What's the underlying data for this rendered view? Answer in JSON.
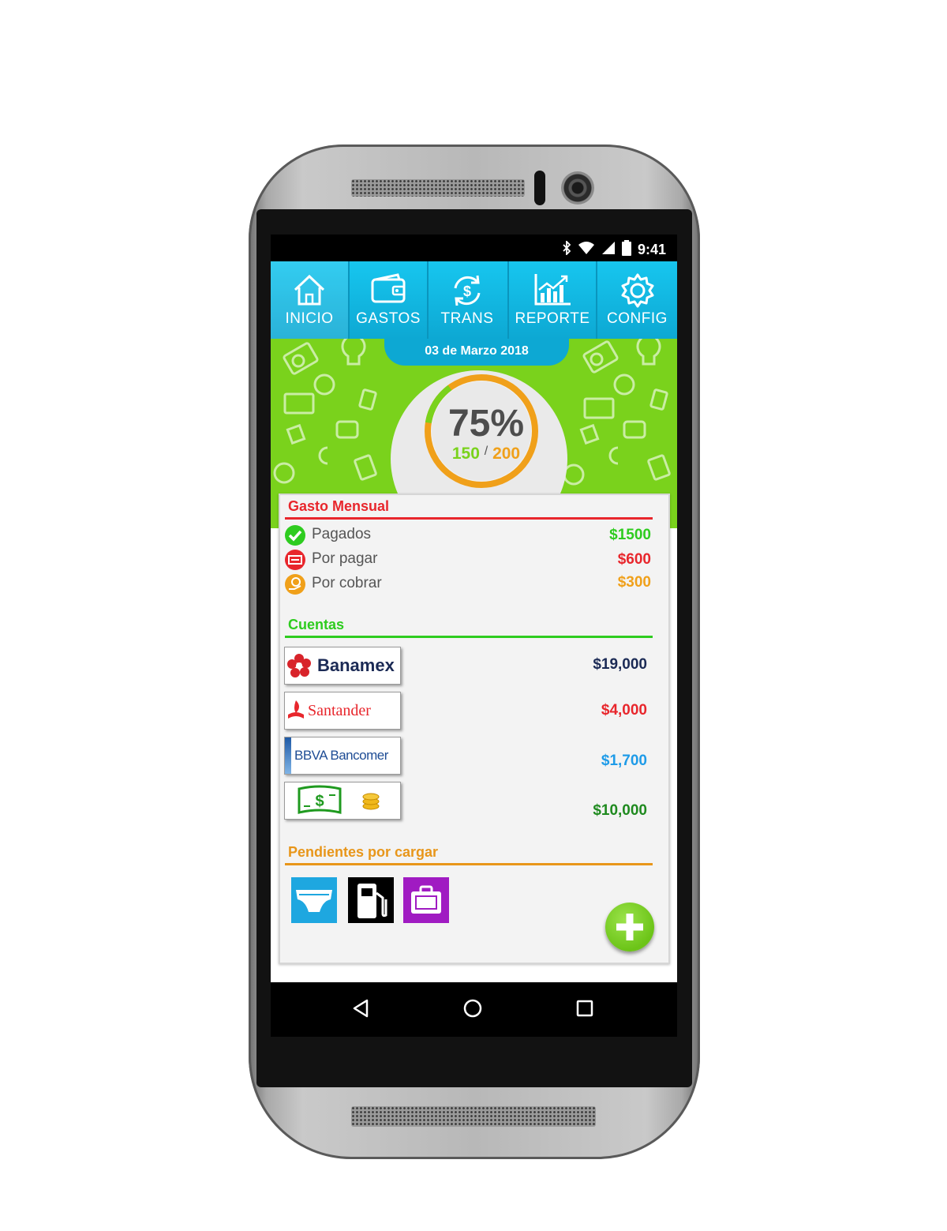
{
  "status_bar": {
    "time": "9:41"
  },
  "nav": {
    "items": [
      {
        "label": "INICIO",
        "icon": "home-icon"
      },
      {
        "label": "GASTOS",
        "icon": "wallet-icon"
      },
      {
        "label": "TRANS",
        "icon": "transfer-icon"
      },
      {
        "label": "REPORTE",
        "icon": "report-icon"
      },
      {
        "label": "CONFIG",
        "icon": "gear-icon"
      }
    ]
  },
  "header": {
    "date": "03 de Marzo 2018",
    "progress_percent_label": "75%",
    "progress_fraction": 0.75,
    "current": "150",
    "separator": "/",
    "total": "200"
  },
  "gasto_mensual": {
    "title": "Gasto Mensual",
    "rows": [
      {
        "label": "Pagados",
        "value": "$1500",
        "color": "#2ecc1f",
        "icon": "check-icon"
      },
      {
        "label": "Por pagar",
        "value": "$600",
        "color": "#e8262c",
        "icon": "bill-icon"
      },
      {
        "label": "Por cobrar",
        "value": "$300",
        "color": "#f0a01a",
        "icon": "coin-hand-icon"
      }
    ]
  },
  "cuentas": {
    "title": "Cuentas",
    "accounts": [
      {
        "name": "Banamex",
        "value": "$19,000",
        "color": "#1b2a55"
      },
      {
        "name": "Santander",
        "value": "$4,000",
        "color": "#e8262c"
      },
      {
        "name": "BBVA Bancomer",
        "value": "$1,700",
        "color": "#1e9be8"
      },
      {
        "name": "cash",
        "value": "$10,000",
        "color": "#1f8a1f"
      }
    ]
  },
  "pendientes": {
    "title": "Pendientes por cargar",
    "items": [
      {
        "icon": "diaper-icon",
        "color": "#1ea7e0"
      },
      {
        "icon": "fuel-icon",
        "color": "#000000"
      },
      {
        "icon": "briefcase-icon",
        "color": "#a01bc2"
      }
    ]
  },
  "colors": {
    "accent": "#0da8d3",
    "green": "#7ad21c",
    "red_line": "#e8262c",
    "green_line": "#2ecc1f",
    "orange_line": "#e8961a"
  }
}
